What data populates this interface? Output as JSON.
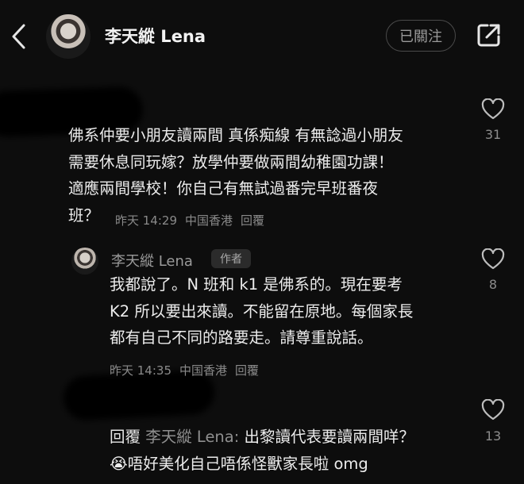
{
  "header": {
    "title": "李天縱 Lena",
    "follow_label": "已關注"
  },
  "comments": [
    {
      "lines": [
        "佛系仲要小朋友讀兩間 真係痴線 有無諗過小朋友",
        "需要休息同玩嫁？放學仲要做兩間幼稚園功課！",
        "適應兩間學校！你自己有無試過番完早班番夜",
        "班？"
      ],
      "time": "昨天 14:29",
      "location": "中国香港",
      "reply_label": "回覆",
      "likes": "31"
    },
    {
      "author": "李天縱 Lena",
      "author_tag": "作者",
      "lines": [
        "我都說了。N 班和 k1 是佛系的。現在要考",
        "K2 所以要出來讀。不能留在原地。每個家長",
        "都有自己不同的路要走。請尊重說話。"
      ],
      "time": "昨天 14:35",
      "location": "中国香港",
      "reply_label": "回覆",
      "likes": "8"
    },
    {
      "reply_prefix": "回覆",
      "reply_to": "李天縱 Lena:",
      "line1_rest": "出黎讀代表要讀兩間咩？",
      "emoji": "😭",
      "line2": "唔好美化自己唔係怪獸家長啦 omg",
      "likes": "13"
    }
  ],
  "icons": {
    "back": "chevron-left-icon",
    "share": "share-icon",
    "like": "heart-outline-icon"
  }
}
